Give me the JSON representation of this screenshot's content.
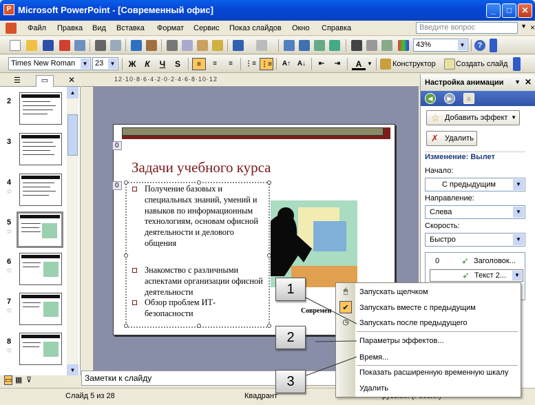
{
  "window": {
    "title": "Microsoft PowerPoint - [Современный офис]",
    "app_icon": "powerpoint-icon"
  },
  "menu": {
    "items": [
      "Файл",
      "Правка",
      "Вид",
      "Вставка",
      "Формат",
      "Сервис",
      "Показ слайдов",
      "Окно",
      "Справка"
    ],
    "help_placeholder": "Введите вопрос"
  },
  "toolbar": {
    "zoom": "43%"
  },
  "formatting": {
    "font": "Times New Roman",
    "size": "23",
    "bold": "Ж",
    "italic": "К",
    "underline": "Ч",
    "shadow": "S",
    "designer": "Конструктор",
    "new_slide": "Создать слайд"
  },
  "thumbnails": {
    "numbers": [
      "2",
      "3",
      "4",
      "5",
      "6",
      "7",
      "8"
    ],
    "selected": "5"
  },
  "ruler": {
    "top": "12·10·8·6·4·2·0·2·4·6·8·10·12"
  },
  "slide": {
    "title": "Задачи учебного курса",
    "badge_title": "0",
    "badge_text": "0",
    "bullets": [
      "Получение базовых и специальных знаний, умений и навыков по информационным технологиям, основам офисной деятельности и делового общения",
      "Знакомство с различными аспектами организации офисной деятельности",
      "Обзор проблем ИТ-безопасности"
    ],
    "footer": "Современ"
  },
  "notes": {
    "placeholder": "Заметки к слайду"
  },
  "status": {
    "slide": "Слайд 5 из 28",
    "design": "Квадрант",
    "lang": "русский (Россия)"
  },
  "taskpane": {
    "title": "Настройка анимации",
    "add_effect": "Добавить эффект",
    "delete": "Удалить",
    "change": "Изменение: Вылет",
    "start_label": "Начало:",
    "start_value": "С предыдущим",
    "direction_label": "Направление:",
    "direction_value": "Слева",
    "speed_label": "Скорость:",
    "speed_value": "Быстро",
    "list": [
      {
        "num": "0",
        "name": "Заголовок..."
      },
      {
        "num": "",
        "name": "Текст 2..."
      }
    ]
  },
  "context_menu": {
    "items": [
      "Запускать щелчком",
      "Запускать вместе с предыдущим",
      "Запускать после предыдущего",
      "Параметры эффектов...",
      "Время...",
      "Показать расширенную временную шкалу",
      "Удалить"
    ],
    "checked": "Запускать вместе с предыдущим"
  },
  "callouts": [
    "1",
    "2",
    "3"
  ],
  "colors": {
    "titlebar": "#0a5fe8",
    "slide_title": "#7b1818",
    "accent_bar": "#8b8a68",
    "highlight": "#ffc75a"
  }
}
